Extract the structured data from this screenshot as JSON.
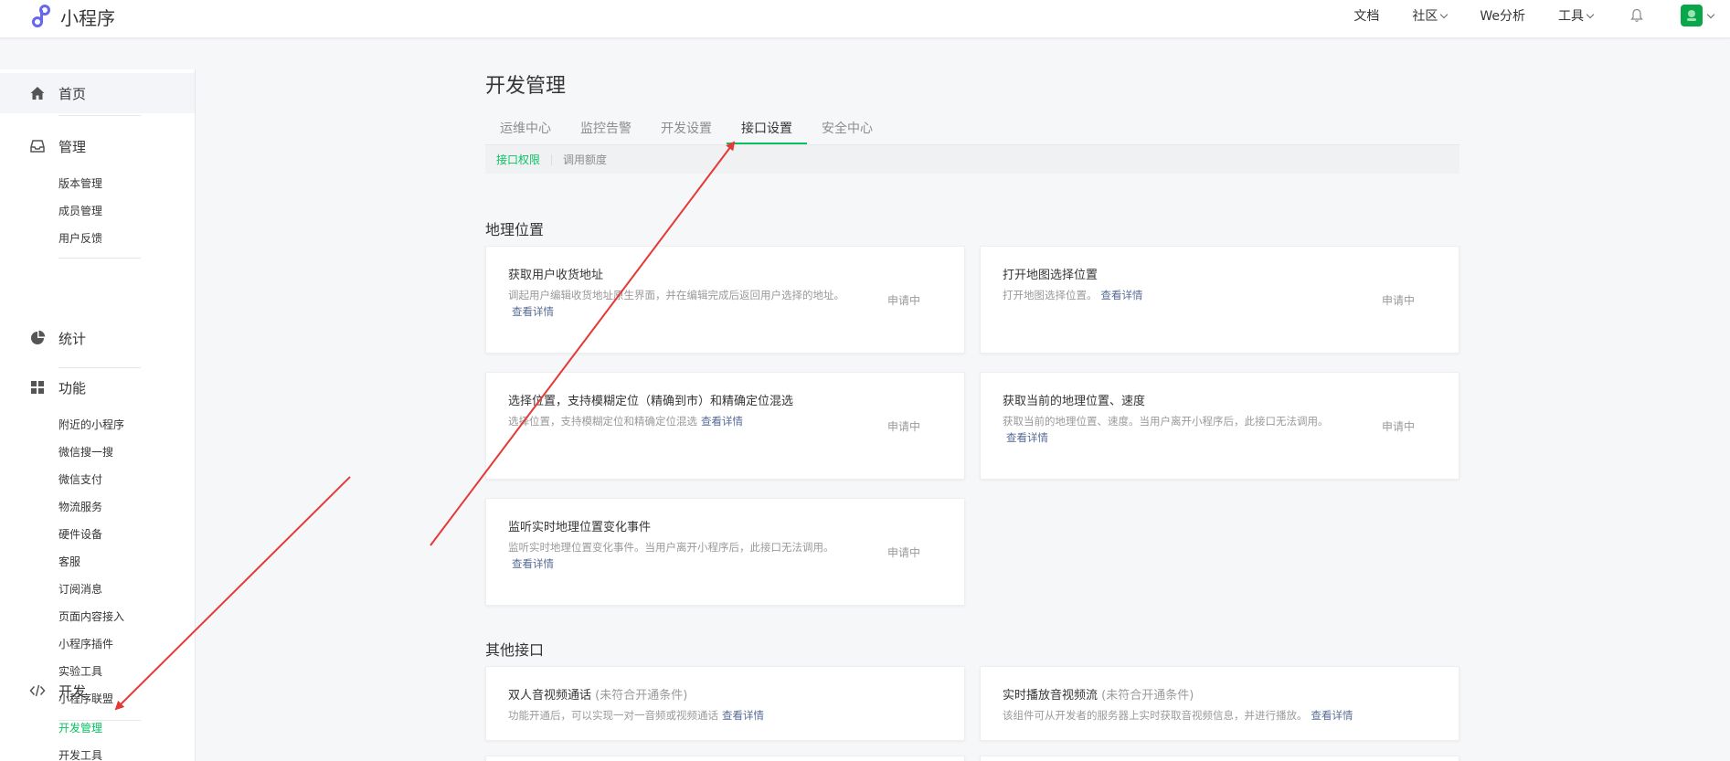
{
  "topnav": {
    "logo_text": "小程序",
    "links": [
      {
        "label": "文档",
        "dropdown": false
      },
      {
        "label": "社区",
        "dropdown": true
      },
      {
        "label": "We分析",
        "dropdown": false
      },
      {
        "label": "工具",
        "dropdown": true
      }
    ]
  },
  "sidebar": {
    "home": "首页",
    "manage": {
      "label": "管理",
      "items": [
        "版本管理",
        "成员管理",
        "用户反馈"
      ]
    },
    "stats": "统计",
    "features": {
      "label": "功能",
      "items": [
        "附近的小程序",
        "微信搜一搜",
        "微信支付",
        "物流服务",
        "硬件设备",
        "客服",
        "订阅消息",
        "页面内容接入",
        "小程序插件",
        "实验工具",
        "小程序联盟"
      ]
    },
    "dev": {
      "label": "开发",
      "items": [
        "开发管理",
        "开发工具"
      ]
    }
  },
  "main": {
    "title": "开发管理",
    "tabs": [
      "运维中心",
      "监控告警",
      "开发设置",
      "接口设置",
      "安全中心"
    ],
    "subtabs": [
      "接口权限",
      "调用额度"
    ],
    "sections": {
      "geo": "地理位置",
      "other": "其他接口"
    },
    "cards": [
      {
        "title": "获取用户收货地址",
        "desc": "调起用户编辑收货地址原生界面，并在编辑完成后返回用户选择的地址。",
        "link": "查看详情",
        "status": "申请中"
      },
      {
        "title": "打开地图选择位置",
        "desc": "打开地图选择位置。",
        "link": "查看详情",
        "status": "申请中"
      },
      {
        "title": "选择位置，支持模糊定位（精确到市）和精确定位混选",
        "desc": "选择位置，支持模糊定位和精确定位混选",
        "link": "查看详情",
        "status": "申请中"
      },
      {
        "title": "获取当前的地理位置、速度",
        "desc": "获取当前的地理位置、速度。当用户离开小程序后，此接口无法调用。",
        "link": "查看详情",
        "status": "申请中"
      },
      {
        "title": "监听实时地理位置变化事件",
        "desc": "监听实时地理位置变化事件。当用户离开小程序后，此接口无法调用。",
        "link": "查看详情",
        "status": "申请中"
      },
      {
        "title": "双人音视频通话",
        "muted": "(未符合开通条件)",
        "desc": "功能开通后，可以实现一对一音频或视频通话",
        "link": "查看详情"
      },
      {
        "title": "实时播放音视频流",
        "muted": "(未符合开通条件)",
        "desc": "该组件可从开发者的服务器上实时获取音视频信息，并进行播放。",
        "link": "查看详情"
      }
    ]
  },
  "colors": {
    "accent": "#07c160",
    "link": "#576b95",
    "arrow": "#e53935"
  }
}
